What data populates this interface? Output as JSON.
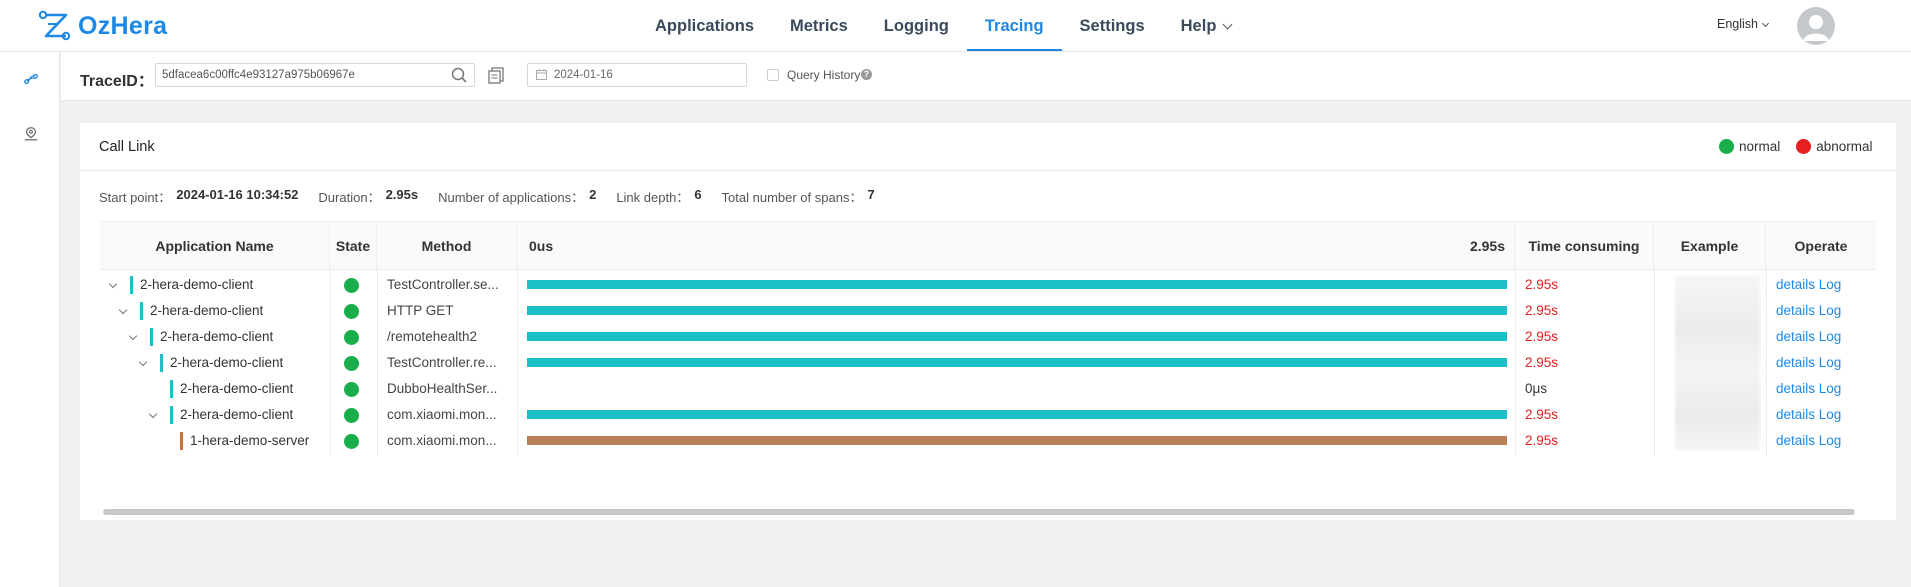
{
  "brand": {
    "name": "OzHera",
    "color": "#1e88e5"
  },
  "nav": {
    "items": [
      {
        "label": "Applications",
        "active": false
      },
      {
        "label": "Metrics",
        "active": false
      },
      {
        "label": "Logging",
        "active": false
      },
      {
        "label": "Tracing",
        "active": true
      },
      {
        "label": "Settings",
        "active": false
      },
      {
        "label": "Help",
        "active": false,
        "dropdown": true
      }
    ],
    "language": "English"
  },
  "sidebar": {
    "icons": [
      "trace-link-icon",
      "location-pin-icon"
    ]
  },
  "toolbar": {
    "trace_label": "TraceID：",
    "trace_value": "5dfacea6c00ffc4e93127a975b06967e",
    "date_value": "2024-01-16",
    "query_history_label": "Query History",
    "query_history_checked": false
  },
  "card": {
    "title": "Call Link",
    "legend": {
      "normal": "normal",
      "abnormal": "abnormal",
      "normal_color": "#1aad4b",
      "abnormal_color": "#e62020"
    },
    "stats": {
      "start_label": "Start point：",
      "start_value": "2024-01-16 10:34:52",
      "duration_label": "Duration：",
      "duration_value": "2.95s",
      "apps_label": "Number of applications：",
      "apps_value": "2",
      "depth_label": "Link depth：",
      "depth_value": "6",
      "spans_label": "Total number of spans：",
      "spans_value": "7"
    }
  },
  "table": {
    "headers": {
      "app": "Application Name",
      "state": "State",
      "method": "Method",
      "timeline_start": "0us",
      "timeline_end": "2.95s",
      "time": "Time consuming",
      "example": "Example",
      "operate": "Operate"
    },
    "rows": [
      {
        "depth": 0,
        "expandable": true,
        "app": "2-hera-demo-client",
        "method": "TestController.se...",
        "fraction": 1.0,
        "time": "2.95s",
        "time_color": "#e02020",
        "bar_color": "#1bbfc6",
        "tag_color": "#1bbfc6",
        "ops": "details Log"
      },
      {
        "depth": 1,
        "expandable": true,
        "app": "2-hera-demo-client",
        "method": "HTTP GET",
        "fraction": 1.0,
        "time": "2.95s",
        "time_color": "#e02020",
        "bar_color": "#1bbfc6",
        "tag_color": "#1bbfc6",
        "ops": "details Log"
      },
      {
        "depth": 2,
        "expandable": true,
        "app": "2-hera-demo-client",
        "method": "/remotehealth2",
        "fraction": 1.0,
        "time": "2.95s",
        "time_color": "#e02020",
        "bar_color": "#1bbfc6",
        "tag_color": "#1bbfc6",
        "ops": "details Log"
      },
      {
        "depth": 3,
        "expandable": true,
        "app": "2-hera-demo-client",
        "method": "TestController.re...",
        "fraction": 1.0,
        "time": "2.95s",
        "time_color": "#e02020",
        "bar_color": "#1bbfc6",
        "tag_color": "#1bbfc6",
        "ops": "details Log"
      },
      {
        "depth": 4,
        "expandable": false,
        "app": "2-hera-demo-client",
        "method": "DubboHealthSer...",
        "fraction": 0.0,
        "time": "0μs",
        "time_color": "#333333",
        "bar_color": "#1bbfc6",
        "tag_color": "#1bbfc6",
        "ops": "details Log"
      },
      {
        "depth": 4,
        "expandable": true,
        "app": "2-hera-demo-client",
        "method": "com.xiaomi.mon...",
        "fraction": 1.0,
        "time": "2.95s",
        "time_color": "#e02020",
        "bar_color": "#1bbfc6",
        "tag_color": "#1bbfc6",
        "ops": "details Log"
      },
      {
        "depth": 5,
        "expandable": false,
        "app": "1-hera-demo-server",
        "method": "com.xiaomi.mon...",
        "fraction": 1.0,
        "time": "2.95s",
        "time_color": "#e02020",
        "bar_color": "#b97f58",
        "tag_color": "#c9733a",
        "ops": "details Log"
      }
    ]
  }
}
